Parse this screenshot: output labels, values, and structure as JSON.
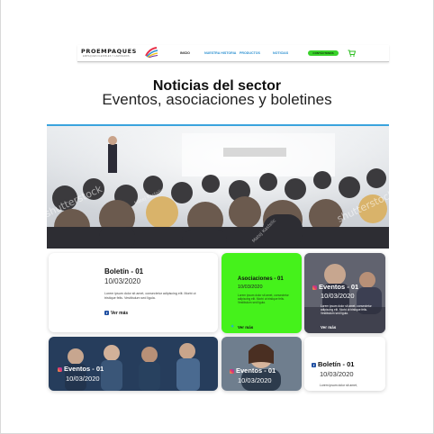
{
  "nav": {
    "logo_text": "PROEMPAQUES",
    "logo_tagline": "EMPAQUES FLEXIBLES Y LAMINADOS",
    "items": [
      {
        "label": "INICIO"
      },
      {
        "label": "NUESTRA HISTORIA"
      },
      {
        "label": "PRODUCTOS"
      },
      {
        "label": "NOTICIAS"
      }
    ],
    "cta_label": "CONTÁCTENOS",
    "cart_icon": "cart-icon"
  },
  "page": {
    "title": "Noticias del sector",
    "subtitle": "Eventos, asociaciones y boletines"
  },
  "hero": {
    "watermark": "shutterstock",
    "photographer": "Matej Kastelic"
  },
  "cards": [
    {
      "title": "Boletín - 01",
      "date": "10/03/2020",
      "text": "Lorem ipsum dolor sit amet, consectetur adipiscing elit. Morbi ut tristique felis. Vestibulum sed ligula.",
      "more": "Ver más",
      "icon": "facebook-icon"
    },
    {
      "title": "Asociaciones - 01",
      "date": "10/03/2020",
      "text": "Lorem ipsum dolor sit amet, consectetur adipiscing elit. Morbi ut tristique felis. Vestibulum sed ligula.",
      "more": "Ver más",
      "icon": "twitter-icon"
    },
    {
      "title": "Eventos - 01",
      "date": "10/03/2020",
      "text": "Lorem ipsum dolor sit amet, consectetur adipiscing elit. Morbi ut tristique felis. Vestibulum sed ligula.",
      "more": "Ver más",
      "icon": "instagram-icon"
    },
    {
      "title": "Eventos - 01",
      "date": "10/03/2020",
      "icon": "instagram-icon"
    },
    {
      "title": "Eventos - 01",
      "date": "10/03/2020",
      "icon": "instagram-icon"
    },
    {
      "title": "Boletín - 01",
      "date": "10/03/2020",
      "text": "Lorem ipsum dolor sit amet,",
      "icon": "facebook-icon"
    }
  ],
  "colors": {
    "accent_blue": "#2a8fd0",
    "accent_green": "#45f21b",
    "cta_green": "#39d22a"
  }
}
